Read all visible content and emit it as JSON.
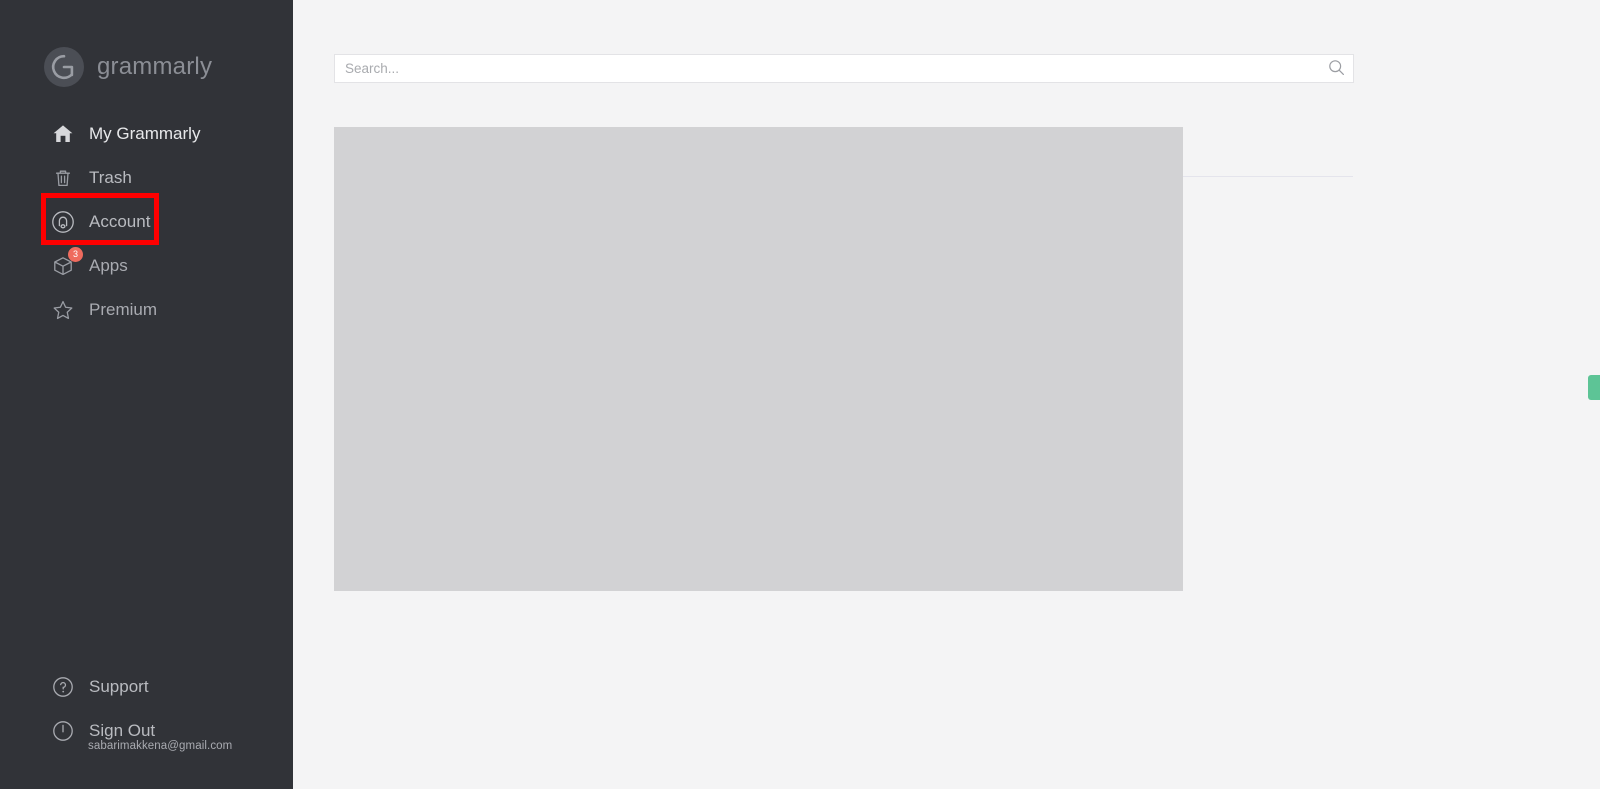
{
  "brand": {
    "name": "grammarly",
    "logo_icon": "grammarly-g-logo"
  },
  "sidebar": {
    "background_color": "#313338",
    "main_items": [
      {
        "label": "My Grammarly",
        "icon": "home-icon",
        "active": true
      },
      {
        "label": "Trash",
        "icon": "trash-icon",
        "active": false
      },
      {
        "label": "Account",
        "icon": "account-circle-icon",
        "active": false,
        "highlighted": true
      },
      {
        "label": "Apps",
        "icon": "box-icon",
        "active": false,
        "badge": "3"
      },
      {
        "label": "Premium",
        "icon": "star-icon",
        "active": false
      }
    ],
    "bottom_items": [
      {
        "label": "Support",
        "icon": "question-circle-icon"
      },
      {
        "label": "Sign Out",
        "icon": "power-icon"
      }
    ],
    "account_email": "sabarimakkena@gmail.com"
  },
  "highlight": {
    "target": "Account",
    "color": "#fe0000"
  },
  "search": {
    "placeholder": "Search...",
    "value": "",
    "icon": "search-icon"
  },
  "main": {
    "background_color": "#f4f4f5",
    "placeholder_block_color": "#d2d2d4",
    "divider_color": "#e4e4ec"
  },
  "edge_tab": {
    "color": "#5dc496",
    "name": "feedback-tab"
  }
}
